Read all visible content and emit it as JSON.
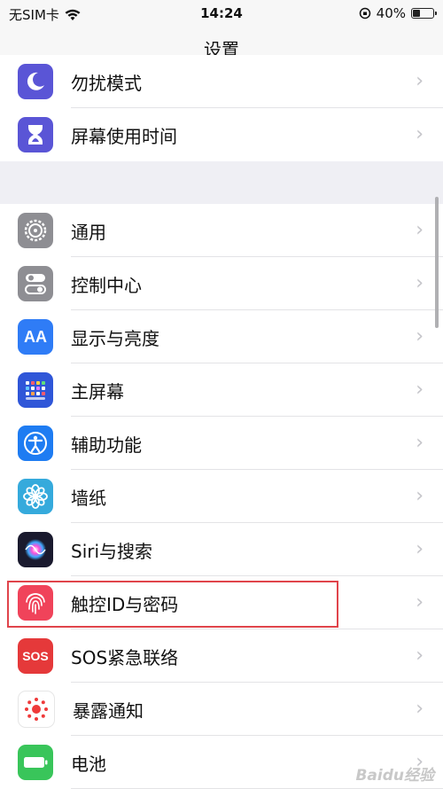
{
  "status_bar": {
    "carrier": "无SIM卡",
    "time": "14:24",
    "battery_percent_label": "40%",
    "battery_level": 0.4
  },
  "nav": {
    "title": "设置"
  },
  "group1": [
    {
      "label": "勿扰模式",
      "icon": "moon-icon",
      "color": "#5a55d6"
    },
    {
      "label": "屏幕使用时间",
      "icon": "hourglass-icon",
      "color": "#5a55d6"
    }
  ],
  "group2": [
    {
      "label": "通用",
      "icon": "gear-icon",
      "color": "#8e8e93"
    },
    {
      "label": "控制中心",
      "icon": "toggles-icon",
      "color": "#8e8e93"
    },
    {
      "label": "显示与亮度",
      "icon": "display-aa-icon",
      "color": "#2f7cf6",
      "icon_text": "AA"
    },
    {
      "label": "主屏幕",
      "icon": "home-screen-grid-icon",
      "color": "#2f56d8"
    },
    {
      "label": "辅助功能",
      "icon": "accessibility-icon",
      "color": "#1e7cf2"
    },
    {
      "label": "墙纸",
      "icon": "wallpaper-flower-icon",
      "color": "#35aadc"
    },
    {
      "label": "Siri与搜索",
      "icon": "siri-icon",
      "color": "#1a1a2e"
    },
    {
      "label": "触控ID与密码",
      "icon": "fingerprint-icon",
      "color": "#f0435a"
    },
    {
      "label": "SOS紧急联络",
      "icon": "sos-icon",
      "color": "#e5393a",
      "icon_text": "SOS"
    },
    {
      "label": "暴露通知",
      "icon": "exposure-notification-icon",
      "color": "#ffffff"
    },
    {
      "label": "电池",
      "icon": "battery-icon",
      "color": "#39c55a"
    }
  ],
  "watermark": "Baidu经验"
}
